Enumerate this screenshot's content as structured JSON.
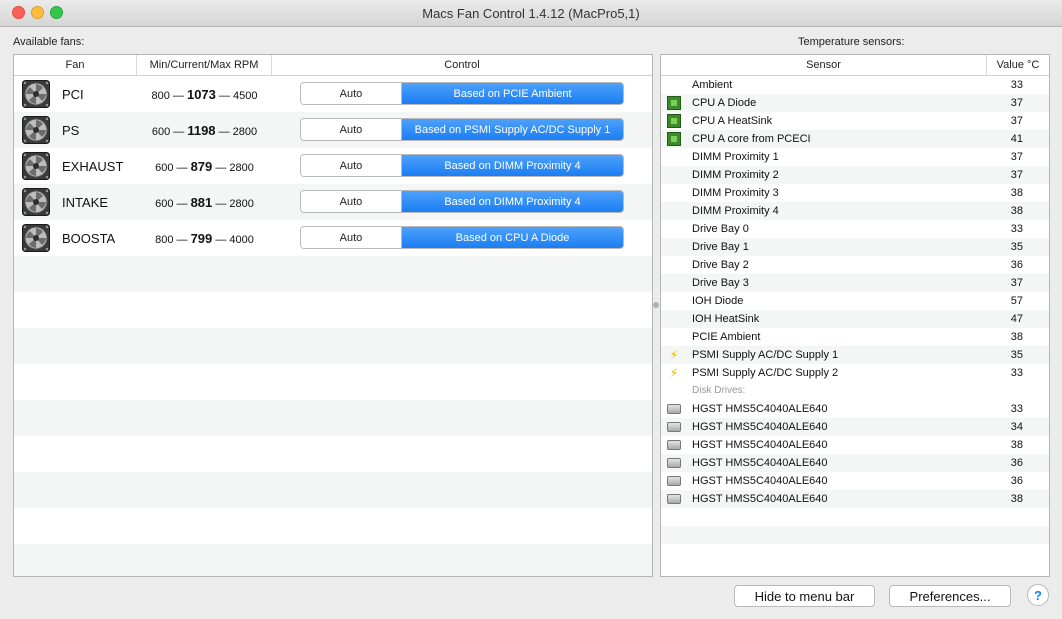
{
  "window": {
    "title": "Macs Fan Control 1.4.12 (MacPro5,1)"
  },
  "fans_panel": {
    "label": "Available fans:",
    "columns": {
      "fan": "Fan",
      "rpm": "Min/Current/Max RPM",
      "control": "Control"
    },
    "rows": [
      {
        "name": "PCI",
        "min": "800",
        "current": "1073",
        "max": "4500",
        "auto_label": "Auto",
        "based_label": "Based on PCIE Ambient"
      },
      {
        "name": "PS",
        "min": "600",
        "current": "1198",
        "max": "2800",
        "auto_label": "Auto",
        "based_label": "Based on PSMI Supply AC/DC Supply 1"
      },
      {
        "name": "EXHAUST",
        "min": "600",
        "current": "879",
        "max": "2800",
        "auto_label": "Auto",
        "based_label": "Based on DIMM Proximity 4"
      },
      {
        "name": "INTAKE",
        "min": "600",
        "current": "881",
        "max": "2800",
        "auto_label": "Auto",
        "based_label": "Based on DIMM Proximity 4"
      },
      {
        "name": "BOOSTA",
        "min": "800",
        "current": "799",
        "max": "4000",
        "auto_label": "Auto",
        "based_label": "Based on CPU A Diode"
      }
    ],
    "separator": "—"
  },
  "sensors_panel": {
    "label": "Temperature sensors:",
    "columns": {
      "sensor": "Sensor",
      "value": "Value °C"
    },
    "sensors": [
      {
        "name": "Ambient",
        "value": "33",
        "icon": "none"
      },
      {
        "name": "CPU A Diode",
        "value": "37",
        "icon": "cpu-chip-icon"
      },
      {
        "name": "CPU A HeatSink",
        "value": "37",
        "icon": "cpu-chip-icon"
      },
      {
        "name": "CPU A core from PCECI",
        "value": "41",
        "icon": "cpu-chip-icon"
      },
      {
        "name": "DIMM Proximity 1",
        "value": "37",
        "icon": "none"
      },
      {
        "name": "DIMM Proximity 2",
        "value": "37",
        "icon": "none"
      },
      {
        "name": "DIMM Proximity 3",
        "value": "38",
        "icon": "none"
      },
      {
        "name": "DIMM Proximity 4",
        "value": "38",
        "icon": "none"
      },
      {
        "name": "Drive Bay 0",
        "value": "33",
        "icon": "none"
      },
      {
        "name": "Drive Bay 1",
        "value": "35",
        "icon": "none"
      },
      {
        "name": "Drive Bay 2",
        "value": "36",
        "icon": "none"
      },
      {
        "name": "Drive Bay 3",
        "value": "37",
        "icon": "none"
      },
      {
        "name": "IOH Diode",
        "value": "57",
        "icon": "none"
      },
      {
        "name": "IOH HeatSink",
        "value": "47",
        "icon": "none"
      },
      {
        "name": "PCIE Ambient",
        "value": "38",
        "icon": "none"
      },
      {
        "name": "PSMI Supply AC/DC Supply 1",
        "value": "35",
        "icon": "lightning-bolt-icon"
      },
      {
        "name": "PSMI Supply AC/DC Supply 2",
        "value": "33",
        "icon": "lightning-bolt-icon"
      }
    ],
    "disk_group_label": "Disk Drives:",
    "disks": [
      {
        "name": "HGST HMS5C4040ALE640",
        "value": "33"
      },
      {
        "name": "HGST HMS5C4040ALE640",
        "value": "34"
      },
      {
        "name": "HGST HMS5C4040ALE640",
        "value": "38"
      },
      {
        "name": "HGST HMS5C4040ALE640",
        "value": "36"
      },
      {
        "name": "HGST HMS5C4040ALE640",
        "value": "36"
      },
      {
        "name": "HGST HMS5C4040ALE640",
        "value": "38"
      }
    ]
  },
  "footer": {
    "hide_label": "Hide to menu bar",
    "preferences_label": "Preferences...",
    "help_label": "?"
  },
  "colors": {
    "accent": "#1a7ef3",
    "cpu_icon": "#3d8a2a",
    "bolt_icon": "#e6b800"
  }
}
